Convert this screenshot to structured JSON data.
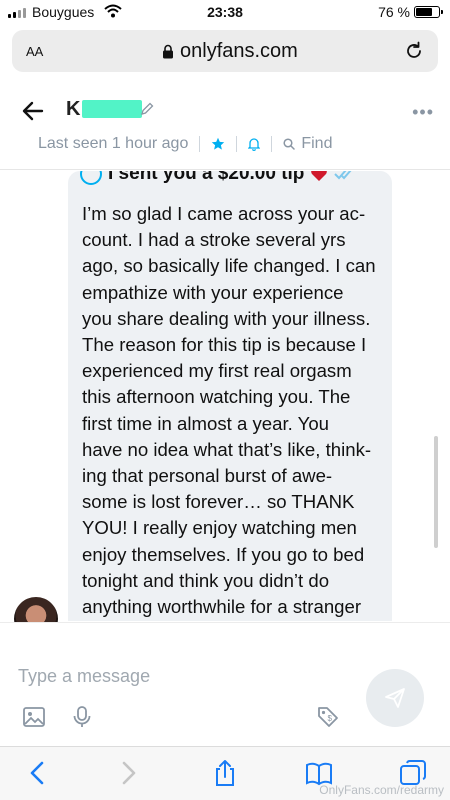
{
  "status_bar": {
    "carrier": "Bouygues",
    "time": "23:38",
    "battery_percent": "76 %",
    "battery_level": 0.76
  },
  "browser": {
    "text_size_button": "AA",
    "url": "onlyfans.com"
  },
  "chat_header": {
    "contact_name": "K",
    "last_seen": "Last seen 1 hour ago",
    "find_label": "Find"
  },
  "message": {
    "tip_text": "I sent you a $20.00 tip",
    "text": "I’m so glad I came across your ac-\ncount. I had a stroke several yrs\nago, so basically life changed. I can\nempathize with your experience\nyou share dealing with your illness.\nThe reason for this tip is because I\nexperienced my first real orgasm\nthis afternoon watching you. The\nfirst time in almost a year. You\nhave no idea what that’s like, think-\ning that personal burst of awe-\nsome is lost forever… so THANK\nYOU! I really enjoy watching men\nenjoy themselves. If you go to bed\ntonight and think you didn’t do\nanything worthwhile for a stranger\ntoday, you’d be wrong. Today, you\nmade a guy in Pittsburgh feel alive"
  },
  "composer": {
    "placeholder": "Type a message"
  },
  "watermark": "OnlyFans.com/redarmy",
  "colors": {
    "accent": "#00aff0",
    "muted": "#8a96a3",
    "bubble": "#eef1f4",
    "heart": "#d0192c",
    "name_redaction": "#52f3c7"
  },
  "icons": [
    "back-arrow-icon",
    "edit-icon",
    "more-dots-icon",
    "star-icon",
    "bell-icon",
    "search-icon",
    "dollar-icon",
    "heart-icon",
    "double-check-icon",
    "image-icon",
    "microphone-icon",
    "price-tag-icon",
    "send-icon",
    "browser-back-icon",
    "browser-forward-icon",
    "share-icon",
    "bookmarks-icon",
    "tabs-icon",
    "lock-icon",
    "reload-icon"
  ]
}
